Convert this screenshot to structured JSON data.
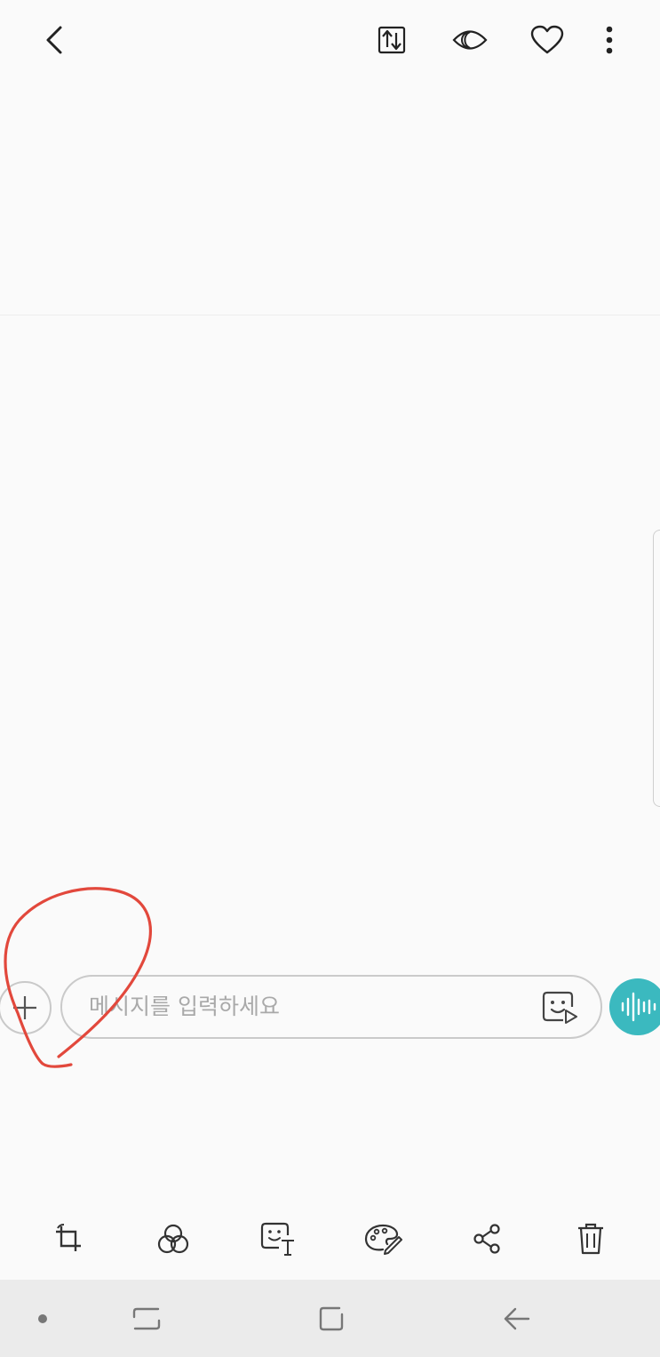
{
  "top_bar": {
    "icons": [
      "back-icon",
      "share-transfer-icon",
      "eye-icon",
      "heart-icon",
      "more-options-icon"
    ]
  },
  "composer": {
    "placeholder": "메시지를 입력하세요",
    "plus_icon": "plus-icon",
    "sticker_icon": "sticker-icon",
    "voice_icon": "voice-wave-icon",
    "voice_color": "#3bb9bf"
  },
  "annotation": {
    "color": "#e2483c",
    "shape": "hand-drawn-circle"
  },
  "edit_toolbar": {
    "icons": [
      "rotate-crop-icon",
      "filter-icon",
      "sticker-text-icon",
      "draw-palette-icon",
      "share-icon",
      "delete-icon"
    ]
  },
  "nav_bar": {
    "icons": [
      "dot-icon",
      "recent-apps-icon",
      "home-icon",
      "nav-back-icon"
    ],
    "background": "#ebebeb"
  }
}
